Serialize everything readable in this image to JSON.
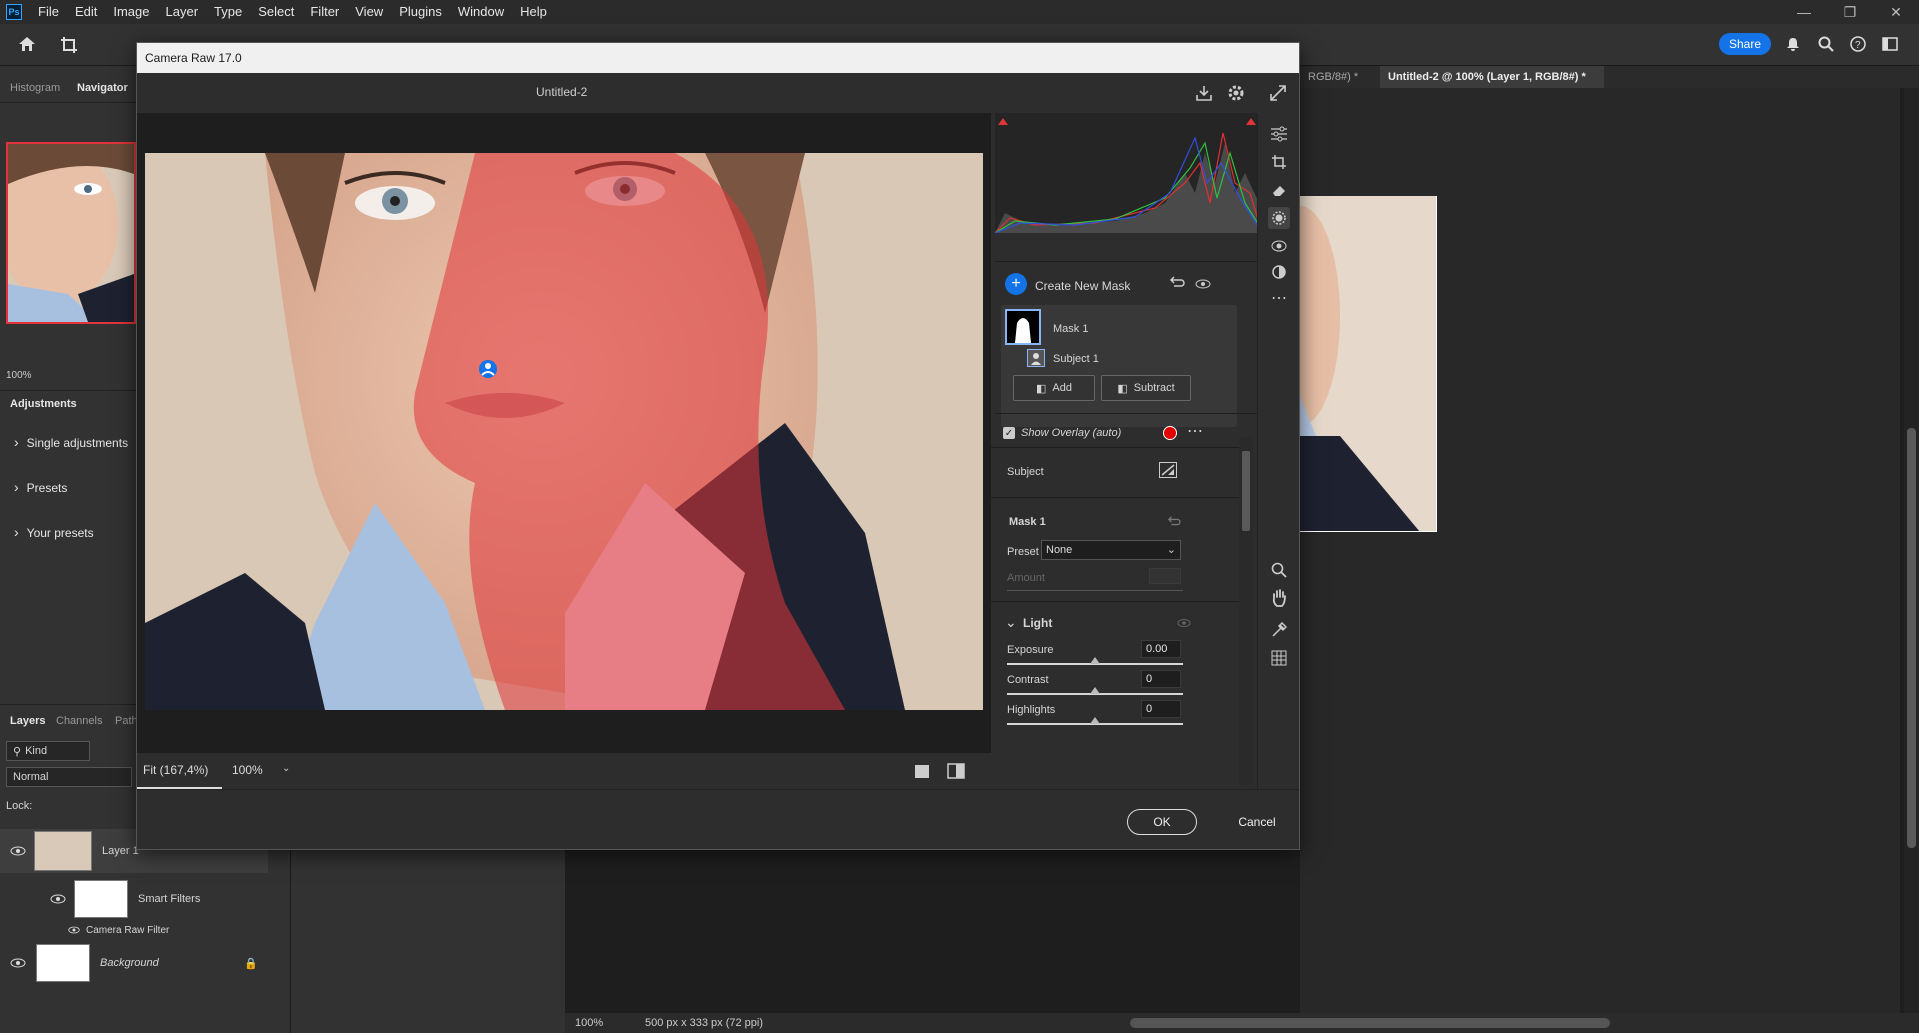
{
  "app": {
    "logo": "Ps",
    "menus": [
      "File",
      "Edit",
      "Image",
      "Layer",
      "Type",
      "Select",
      "Filter",
      "View",
      "Plugins",
      "Window",
      "Help"
    ],
    "share_label": "Share"
  },
  "left_panel": {
    "tabs": [
      "Histogram",
      "Navigator"
    ],
    "zoom": "100%",
    "adjustments_tab": "Adjustments",
    "adjust_items": [
      "Single adjustments",
      "Presets",
      "Your presets"
    ]
  },
  "layers_panel": {
    "tabs": [
      "Layers",
      "Channels",
      "Path"
    ],
    "kind": "Kind",
    "blend": "Normal",
    "lock_label": "Lock:",
    "layers": [
      {
        "name": "Layer 1"
      },
      {
        "name": "Smart Filters"
      },
      {
        "name": "Camera Raw Filter"
      },
      {
        "name": "Background"
      }
    ]
  },
  "document_tabs": [
    {
      "label": "RGB/8#) *"
    },
    {
      "label": "Untitled-2 @ 100% (Layer 1, RGB/8#) *"
    }
  ],
  "status": {
    "zoom": "100%",
    "info": "500 px x 333 px (72 ppi)"
  },
  "camera_raw": {
    "title": "Camera Raw 17.0",
    "doc_name": "Untitled-2",
    "fit_label": "Fit (167,4%)",
    "zoom_value": "100%",
    "create_mask": "Create New Mask",
    "mask_name": "Mask 1",
    "subject_name": "Subject 1",
    "add_label": "Add",
    "subtract_label": "Subtract",
    "show_overlay": "Show Overlay (auto)",
    "subject_section": "Subject",
    "mask_section": "Mask 1",
    "preset_label": "Preset",
    "preset_value": "None",
    "amount_label": "Amount",
    "light_section": "Light",
    "sliders": [
      {
        "label": "Exposure",
        "value": "0.00"
      },
      {
        "label": "Contrast",
        "value": "0"
      },
      {
        "label": "Highlights",
        "value": "0"
      }
    ],
    "ok_label": "OK",
    "cancel_label": "Cancel",
    "colors": {
      "overlay": "#e0343a",
      "accent": "#1473e6"
    }
  }
}
